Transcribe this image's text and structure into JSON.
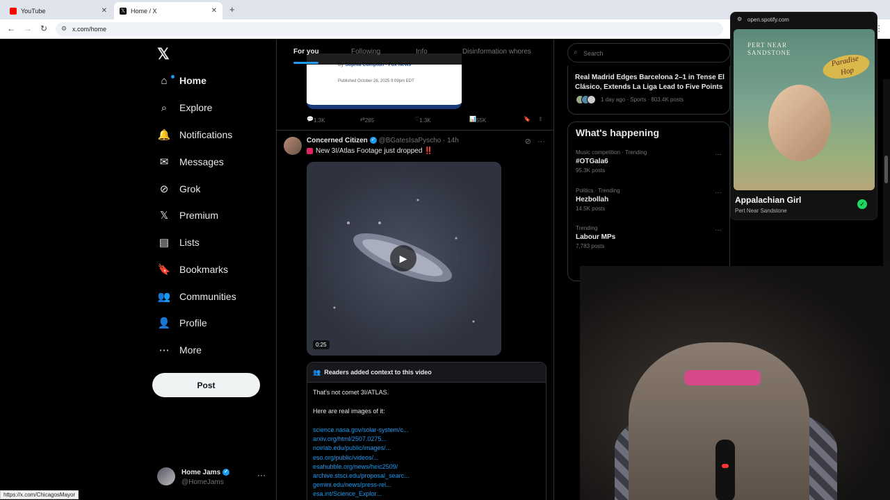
{
  "browser": {
    "tabs": [
      {
        "label": "YouTube",
        "close": "✕"
      },
      {
        "label": "Home / X",
        "close": "✕"
      }
    ],
    "new_tab": "+",
    "url": "x.com/home",
    "status_url": "https://x.com/ChicagosMayor"
  },
  "sidebar": {
    "logo": "𝕏",
    "items": [
      {
        "label": "Home",
        "icon": "⌂"
      },
      {
        "label": "Explore",
        "icon": "⌕"
      },
      {
        "label": "Notifications",
        "icon": "🔔"
      },
      {
        "label": "Messages",
        "icon": "✉"
      },
      {
        "label": "Grok",
        "icon": "⊘"
      },
      {
        "label": "Premium",
        "icon": "𝕏"
      },
      {
        "label": "Lists",
        "icon": "▤"
      },
      {
        "label": "Bookmarks",
        "icon": "🔖"
      },
      {
        "label": "Communities",
        "icon": "👥"
      },
      {
        "label": "Profile",
        "icon": "👤"
      },
      {
        "label": "More",
        "icon": "⋯"
      }
    ],
    "post_label": "Post",
    "account": {
      "name": "Home Jams",
      "handle": "@HomeJams",
      "more": "···"
    }
  },
  "feed": {
    "tabs": [
      "For you",
      "Following",
      "Info",
      "Disinformation whores"
    ],
    "preview_card": {
      "by": "By",
      "author": "Sophia Compton",
      "dot": "•",
      "outlet": "Fox News",
      "published": "Published October 26, 2025 9:09pm EDT"
    },
    "prev_actions": {
      "replies": "1.3K",
      "reposts": "285",
      "likes": "1.3K",
      "views": "55K"
    },
    "tweet": {
      "name": "Concerned Citizen",
      "handle": "@BGatesIsaPyscho",
      "time": "· 14h",
      "text": "New 3I/Atlas Footage just dropped",
      "emoji_end": "‼️",
      "duration": "0:25",
      "note": {
        "header": "Readers added context to this video",
        "line1": "That's not comet 3I/ATLAS.",
        "line2": "Here are real images of it:",
        "links": [
          "science.nasa.gov/solar-system/c...",
          "arxiv.org/html/2507.0275...",
          "noirlab.edu/public/images/...",
          "eso.org/public/videos/...",
          "esahubble.org/news/heic2509/",
          "archive.stsci.edu/proposal_searc...",
          "gemini.edu/news/press-rel...",
          "esa.int/Science_Explor..."
        ]
      }
    }
  },
  "right": {
    "search_placeholder": "Search",
    "news": {
      "title": "Real Madrid Edges Barcelona 2–1 in Tense El Clásico, Extends La Liga Lead to Five Points",
      "meta": "1 day ago · Sports · 803.4K posts"
    },
    "whats_happening": "What's happening",
    "trends": [
      {
        "context": "Music competition · Trending",
        "title": "#OTGala6",
        "posts": "95.3K posts"
      },
      {
        "context": "Politics · Trending",
        "title": "Hezbollah",
        "posts": "14.5K posts"
      },
      {
        "context": "Trending",
        "title": "Labour MPs",
        "posts": "7,783 posts"
      }
    ]
  },
  "spotify": {
    "url": "open.spotify.com",
    "band_line1": "PERT NEAR",
    "band_line2": "SANDSTONE",
    "album_sign_1": "Paradise",
    "album_sign_2": "Hop",
    "track": "Appalachian Girl",
    "artist": "Pert Near Sandstone"
  },
  "colors": {
    "accent": "#1d9bf0",
    "spotify_green": "#1ed760"
  }
}
